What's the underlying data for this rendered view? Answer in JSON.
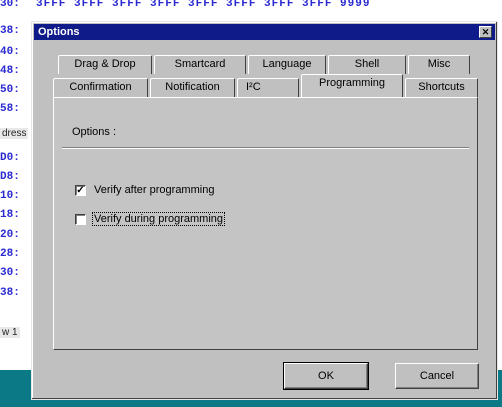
{
  "background": {
    "hex_row": "3FFF 3FFF 3FFF 3FFF 3FFF 3FFF 3FFF 3FFF 9999",
    "address_labels": [
      "30:",
      "38:",
      "40:",
      "48:",
      "50:",
      "58:",
      "D0:",
      "D8:",
      "10:",
      "18:",
      "20:",
      "28:",
      "30:",
      "38:"
    ],
    "side_label_top": "dress",
    "side_label_bottom": "w 1"
  },
  "dialog": {
    "title": "Options",
    "close_glyph": "✕",
    "tabs_row1": [
      "Drag & Drop",
      "Smartcard",
      "Language",
      "Shell",
      "Misc"
    ],
    "tabs_row2": [
      "Confirmation",
      "Notification",
      "I²C",
      "Programming",
      "Shortcuts"
    ],
    "active_tab": "Programming",
    "group_label": "Options :",
    "checkboxes": [
      {
        "label": "Verify after programming",
        "checked": true
      },
      {
        "label": "Verify during programming",
        "checked": false
      }
    ],
    "ok_label": "OK",
    "cancel_label": "Cancel"
  },
  "colors": {
    "titlebar": "#101b8a",
    "dialog_face": "#c0c0c0",
    "editor_text": "#2a2ad0",
    "desktop": "#0b7a86"
  }
}
